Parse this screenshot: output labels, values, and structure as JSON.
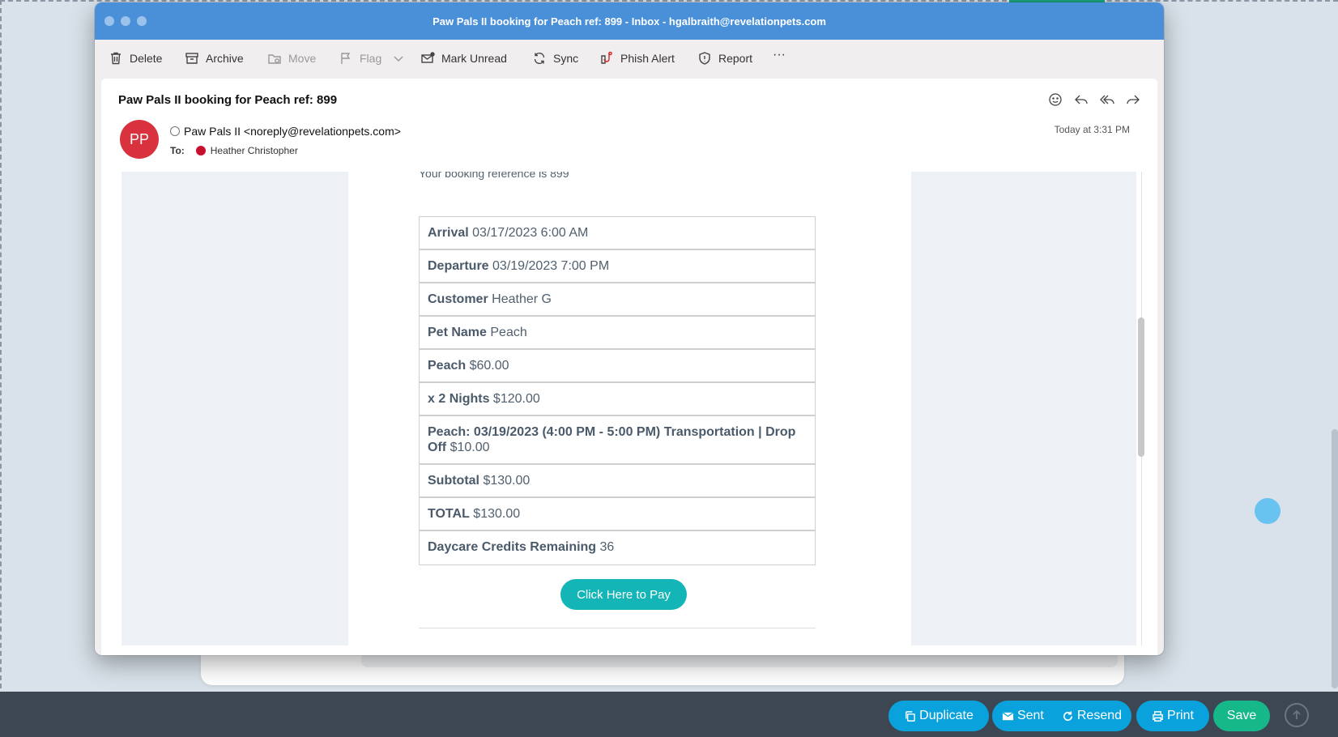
{
  "window": {
    "title": "Paw Pals II  booking for Peach ref: 899 - Inbox - hgalbraith@revelationpets.com"
  },
  "toolbar": {
    "delete": "Delete",
    "archive": "Archive",
    "move": "Move",
    "flag": "Flag",
    "mark_unread": "Mark Unread",
    "sync": "Sync",
    "phish_alert": "Phish Alert",
    "report": "Report",
    "more": "···"
  },
  "message": {
    "subject": "Paw Pals II  booking for Peach ref: 899",
    "avatar_initials": "PP",
    "sender": "Paw Pals II <noreply@revelationpets.com>",
    "to_label": "To:",
    "to_name": "Heather Christopher",
    "timestamp": "Today at 3:31 PM",
    "ref_line": "Your booking reference is 899",
    "rows": [
      {
        "label": "Arrival",
        "value": "03/17/2023 6:00 AM"
      },
      {
        "label": "Departure",
        "value": "03/19/2023 7:00 PM"
      },
      {
        "label": "Customer",
        "value": "Heather G"
      },
      {
        "label": "Pet Name",
        "value": "Peach"
      },
      {
        "label": "Peach",
        "value": "$60.00"
      },
      {
        "label": "x 2 Nights",
        "value": "$120.00"
      },
      {
        "label": "Peach: 03/19/2023 (4:00 PM - 5:00 PM) Transportation | Drop Off",
        "value": "$10.00"
      },
      {
        "label": "Subtotal",
        "value": "$130.00"
      },
      {
        "label": "TOTAL",
        "value": "$130.00"
      },
      {
        "label": "Daycare Credits Remaining",
        "value": "36"
      }
    ],
    "pay_button": "Click Here to Pay"
  },
  "bottom_bar": {
    "duplicate": "Duplicate",
    "sent": "Sent",
    "resend": "Resend",
    "print": "Print",
    "save": "Save"
  },
  "colors": {
    "titlebar": "#4a90d9",
    "avatar": "#d9313d",
    "pay_button": "#14b5b7",
    "action_button": "#0aa2dc",
    "save_button": "#16b88a",
    "bottom_bar": "#3d4653"
  },
  "icons": {
    "delete": "trash-icon",
    "archive": "archive-icon",
    "move": "folder-move-icon",
    "flag": "flag-icon",
    "mark_unread": "envelope-icon",
    "sync": "sync-icon",
    "phish_alert": "phish-hook-icon",
    "report": "shield-icon"
  }
}
